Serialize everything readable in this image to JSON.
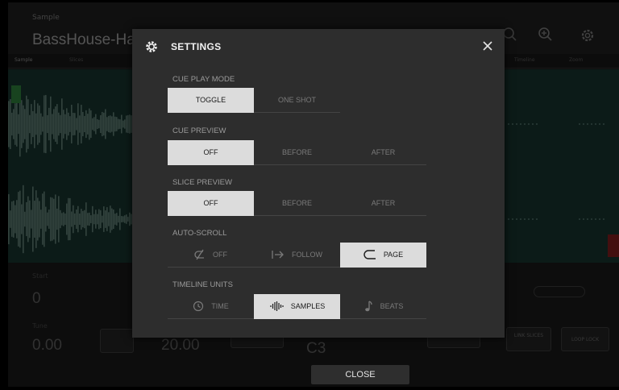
{
  "background": {
    "sample_label": "Sample",
    "sample_name": "BassHouse-Ha",
    "tabs": [
      "Sample",
      "Slices",
      "Timeline",
      "Zoom"
    ],
    "start_label": "Start",
    "start_value": "0",
    "tune_label": "Tune",
    "tune_value": "0.00",
    "mid_value": "20.00",
    "note_value": "C3",
    "link_slices_label": "LINK SLICES",
    "loop_lock_label": "LOOP LOCK",
    "close_label": "CLOSE"
  },
  "modal": {
    "title": "SETTINGS",
    "icon": "gear-icon",
    "sections": {
      "cue_play_mode": {
        "label": "CUE PLAY MODE",
        "options": [
          "TOGGLE",
          "ONE SHOT"
        ],
        "selected": "TOGGLE"
      },
      "cue_preview": {
        "label": "CUE PREVIEW",
        "options": [
          "OFF",
          "BEFORE",
          "AFTER"
        ],
        "selected": "OFF"
      },
      "slice_preview": {
        "label": "SLICE PREVIEW",
        "options": [
          "OFF",
          "BEFORE",
          "AFTER"
        ],
        "selected": "OFF"
      },
      "auto_scroll": {
        "label": "AUTO-SCROLL",
        "options": [
          "OFF",
          "FOLLOW",
          "PAGE"
        ],
        "selected": "PAGE"
      },
      "timeline_units": {
        "label": "TIMELINE UNITS",
        "options": [
          "TIME",
          "SAMPLES",
          "BEATS"
        ],
        "selected": "SAMPLES"
      }
    }
  },
  "colors": {
    "selected_bg": "#dcdcdc",
    "modal_bg": "#2d2d2d",
    "waveform_bg": "#17322d"
  }
}
